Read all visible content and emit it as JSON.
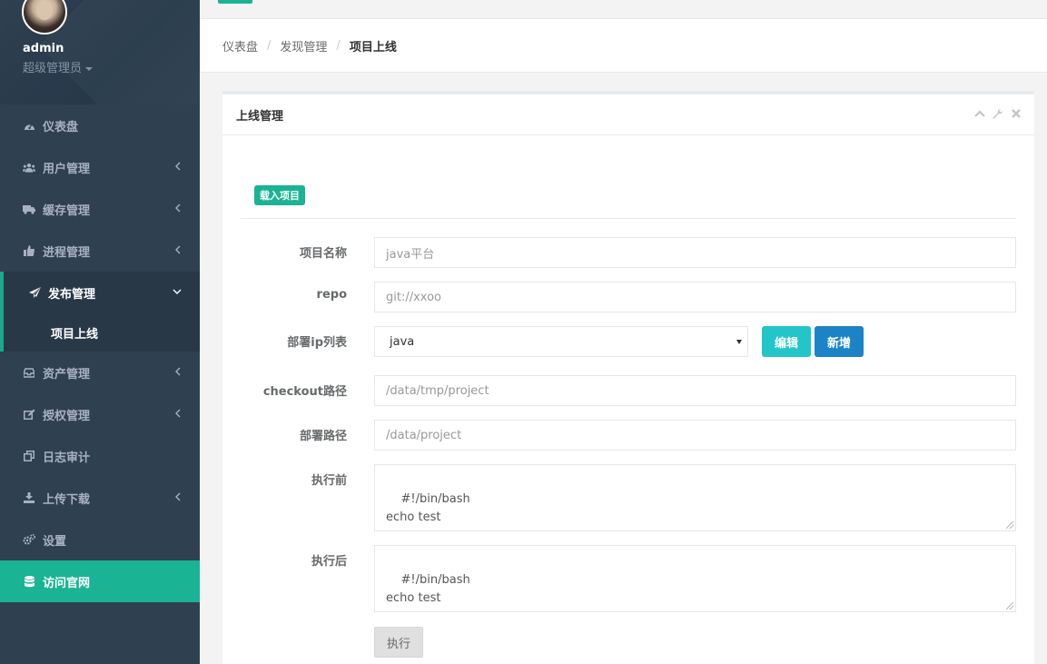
{
  "sidebar": {
    "profile": {
      "name": "admin",
      "role": "超级管理员"
    },
    "items": [
      {
        "label": "仪表盘",
        "icon": "dashboard-icon",
        "has_arrow": false
      },
      {
        "label": "用户管理",
        "icon": "users-icon",
        "has_arrow": true
      },
      {
        "label": "缓存管理",
        "icon": "truck-icon",
        "has_arrow": true
      },
      {
        "label": "进程管理",
        "icon": "thumbs-up-icon",
        "has_arrow": true
      },
      {
        "label": "发布管理",
        "icon": "paper-plane-icon",
        "has_arrow": true,
        "expanded": true
      },
      {
        "label": "资产管理",
        "icon": "inbox-icon",
        "has_arrow": true
      },
      {
        "label": "授权管理",
        "icon": "edit-icon",
        "has_arrow": true
      },
      {
        "label": "日志审计",
        "icon": "copy-icon",
        "has_arrow": false
      },
      {
        "label": "上传下载",
        "icon": "download-icon",
        "has_arrow": true
      },
      {
        "label": "设置",
        "icon": "gears-icon",
        "has_arrow": false
      },
      {
        "label": "访问官网",
        "icon": "database-icon",
        "has_arrow": false
      }
    ],
    "sub_item": "项目上线"
  },
  "breadcrumb": {
    "items": [
      "仪表盘",
      "发现管理",
      "项目上线"
    ],
    "separator": "/"
  },
  "panel": {
    "title": "上线管理",
    "load_badge": "载入项目",
    "fields": {
      "project_name": {
        "label": "项目名称",
        "placeholder": "java平台"
      },
      "repo": {
        "label": "repo",
        "placeholder": "git://xxoo"
      },
      "deploy_ip": {
        "label": "部署ip列表",
        "value": "java"
      },
      "checkout_path": {
        "label": "checkout路径",
        "placeholder": "/data/tmp/project"
      },
      "deploy_path": {
        "label": "部署路径",
        "placeholder": "/data/project"
      },
      "pre_exec": {
        "label": "执行前",
        "value": "#!/bin/bash\necho test"
      },
      "post_exec": {
        "label": "执行后",
        "value": "#!/bin/bash\necho test"
      }
    },
    "buttons": {
      "edit": "编辑",
      "add": "新增",
      "run": "执行"
    }
  },
  "colors": {
    "sidebar_bg": "#2f4050",
    "accent": "#1ab394",
    "info": "#23c6c8",
    "primary": "#1c84c6"
  }
}
